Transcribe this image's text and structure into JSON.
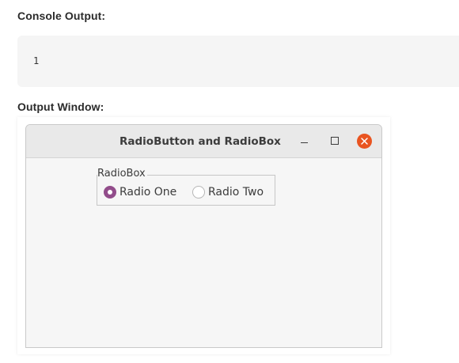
{
  "console": {
    "heading": "Console Output:",
    "output": "1"
  },
  "output_window": {
    "heading": "Output Window:",
    "window": {
      "title": "RadioButton and RadioBox",
      "controls": {
        "minimize": "minimize-icon",
        "maximize": "maximize-icon",
        "close": "close-icon"
      },
      "close_color": "#e95420",
      "radiobox": {
        "label": "RadioBox",
        "options": [
          {
            "label": "Radio One",
            "selected": true
          },
          {
            "label": "Radio Two",
            "selected": false
          }
        ],
        "accent_color": "#924d8b"
      }
    }
  }
}
